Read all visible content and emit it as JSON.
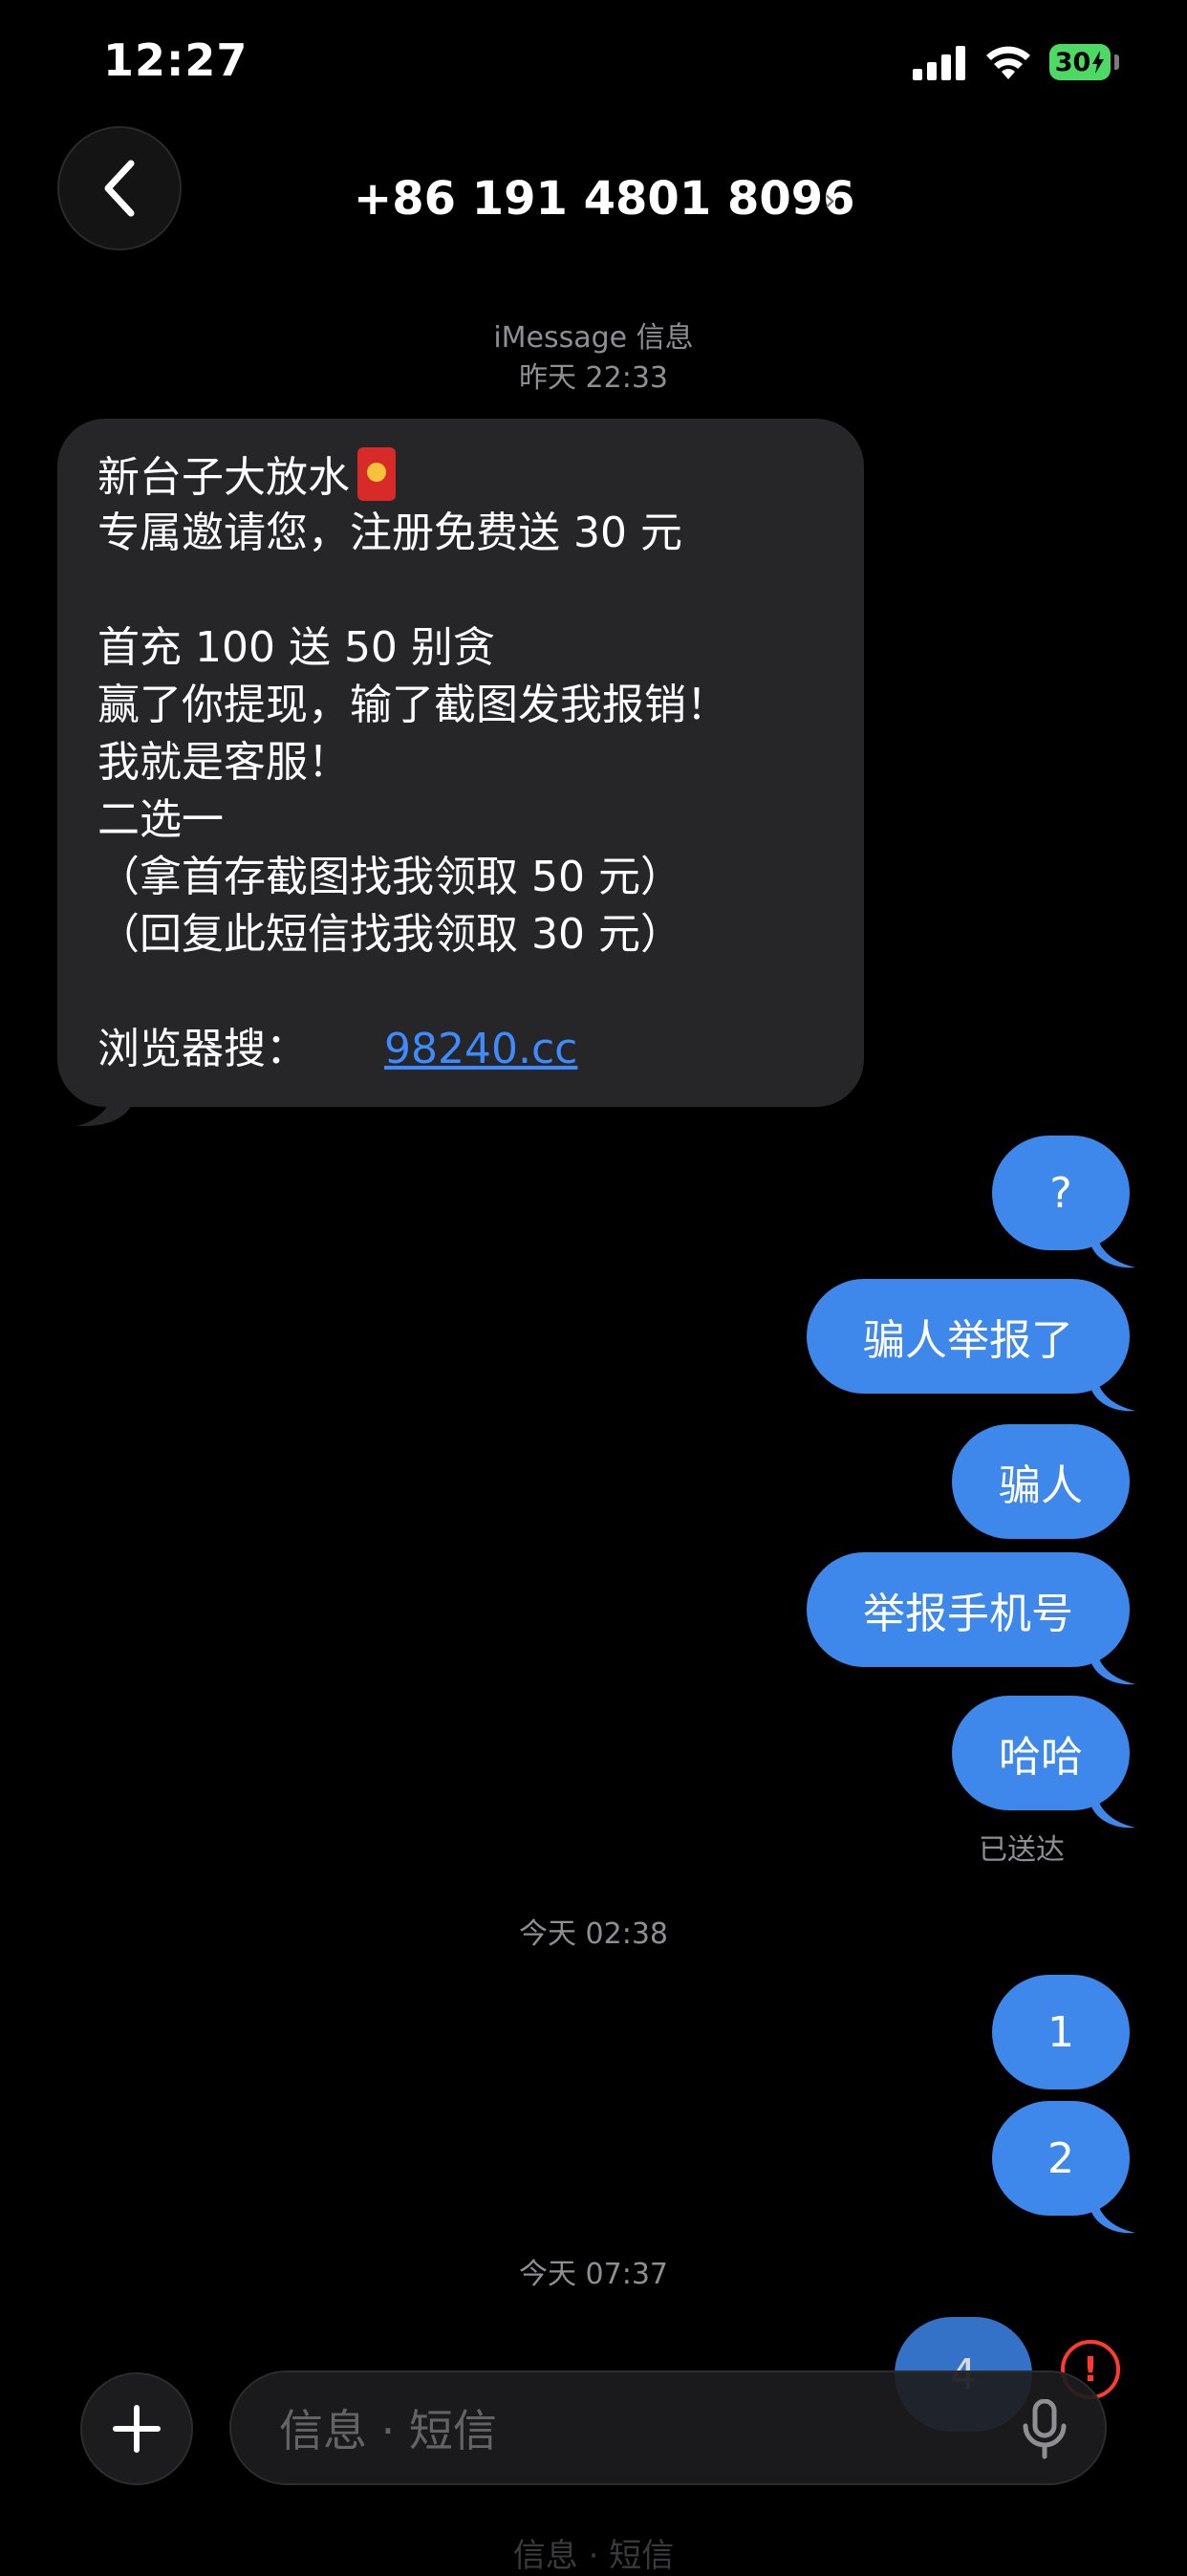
{
  "status_bar": {
    "time": "12:27",
    "battery": "30"
  },
  "header": {
    "contact": "+86 191 4801 8096",
    "chevron": "›"
  },
  "thread": {
    "stamp_1_service": "iMessage 信息",
    "stamp_1_time": "昨天 22:33",
    "incoming_message": {
      "lines": [
        "新台子大放水",
        "专属邀请您，注册免费送 30 元",
        "",
        "首充 100 送 50 别贪",
        "赢了你提现，输了截图发我报销！",
        "我就是客服！",
        "二选一",
        "（拿首存截图找我领取 50 元）",
        "（回复此短信找我领取 30 元）"
      ],
      "link_label": "浏览器搜：",
      "link": "98240.cc"
    },
    "outgoing_1": [
      "?",
      "骗人举报了",
      "骗人",
      "举报手机号",
      "哈哈"
    ],
    "delivered": "已送达",
    "stamp_2": "今天 02:38",
    "outgoing_2": [
      "1",
      "2"
    ],
    "stamp_3": "今天 07:37",
    "outgoing_3": [
      "4"
    ],
    "error_mark": "!"
  },
  "composer": {
    "placeholder": "信息 · 短信",
    "ghost_text": "信息 · 短信"
  },
  "colors": {
    "outgoing_bubble": "#3e87eb",
    "incoming_bubble": "#262628",
    "link": "#3d8bfd",
    "error": "#ff3b30"
  },
  "icons": {
    "back": "chevron-left-icon",
    "add": "plus-icon",
    "mic": "microphone-icon",
    "error": "exclamation-circle-icon"
  }
}
